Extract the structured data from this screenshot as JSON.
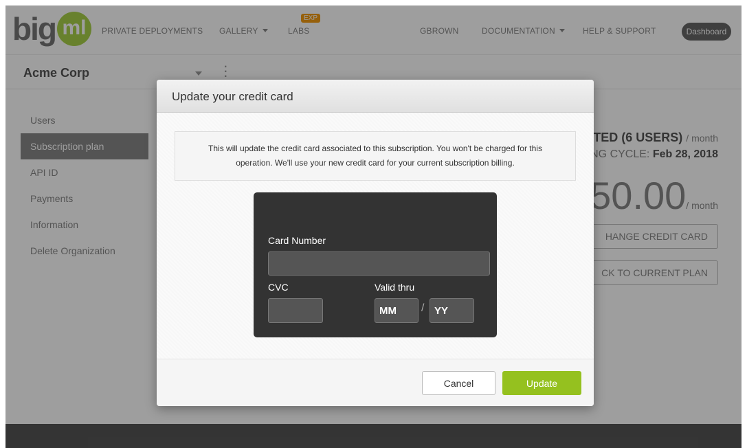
{
  "header": {
    "logo_big": "big",
    "logo_ml": "ml",
    "nav": {
      "private_deployments": "PRIVATE DEPLOYMENTS",
      "gallery": "GALLERY",
      "labs": "LABS",
      "labs_badge": "EXP",
      "user": "GBROWN",
      "documentation": "DOCUMENTATION",
      "help": "HELP & SUPPORT",
      "dashboard": "Dashboard"
    }
  },
  "org": {
    "name": "Acme Corp"
  },
  "sidebar": {
    "items": [
      {
        "label": "Users"
      },
      {
        "label": "Subscription plan",
        "active": true
      },
      {
        "label": "API ID"
      },
      {
        "label": "Payments"
      },
      {
        "label": "Information"
      },
      {
        "label": "Delete Organization"
      }
    ]
  },
  "plan": {
    "line1": "TED (6 USERS)",
    "line1_unit": "/ month",
    "line2_prefix": "NG CYCLE:",
    "line2_date": "Feb 28, 2018",
    "price": "50.00",
    "price_unit": "/ month",
    "change_card": "HANGE CREDIT CARD",
    "back_plan": "CK TO CURRENT PLAN"
  },
  "modal": {
    "title": "Update your credit card",
    "notice_line1": "This will update the credit card associated to this subscription. You won't be charged for this",
    "notice_line2": "operation. We'll use your new credit card for your current subscription billing.",
    "card": {
      "card_number_label": "Card Number",
      "card_number_value": "",
      "cvc_label": "CVC",
      "cvc_value": "",
      "valid_thru_label": "Valid thru",
      "mm_placeholder": "MM",
      "yy_placeholder": "YY",
      "separator": "/"
    },
    "cancel_label": "Cancel",
    "update_label": "Update"
  },
  "colors": {
    "brand_green": "#95c11f",
    "logo_green": "#a9d04a",
    "card_bg": "#333333"
  }
}
